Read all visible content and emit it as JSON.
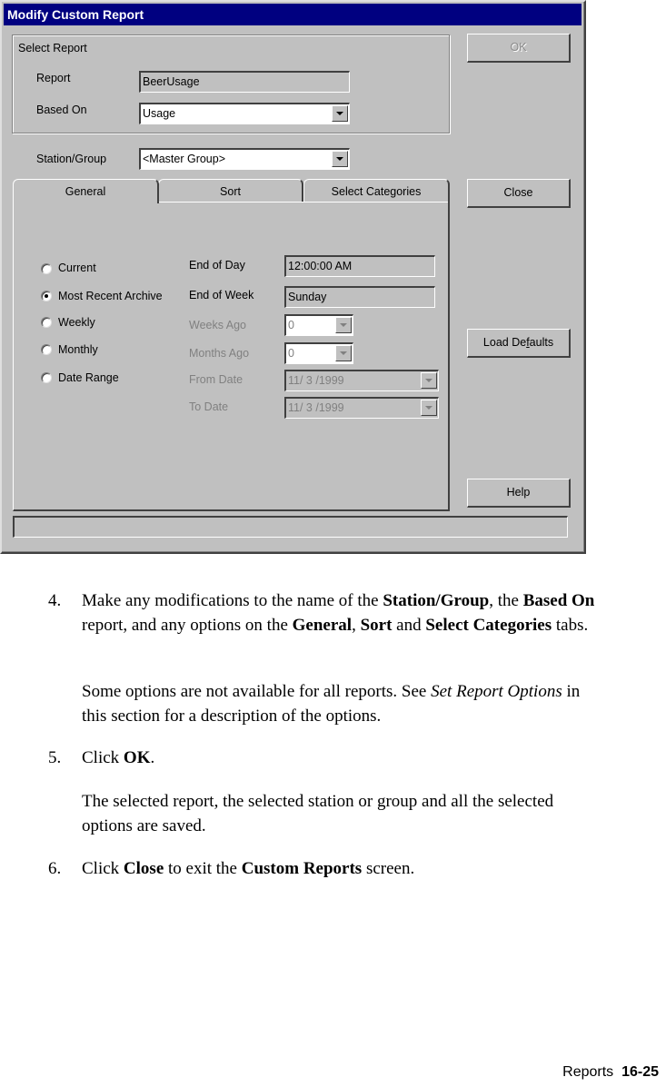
{
  "dialog": {
    "title": "Modify Custom Report",
    "select_report_group": {
      "legend": "Select Report",
      "report_label": "Report",
      "report_value": "BeerUsage",
      "based_on_label": "Based On",
      "based_on_value": "Usage"
    },
    "station_group_label": "Station/Group",
    "station_group_value": "<Master Group>",
    "tabs": [
      {
        "label": "General",
        "active": true
      },
      {
        "label": "Sort",
        "active": false
      },
      {
        "label": "Select Categories",
        "active": false
      }
    ],
    "general": {
      "radios": [
        {
          "label": "Current",
          "checked": false
        },
        {
          "label": "Most Recent Archive",
          "checked": true
        },
        {
          "label": "Weekly",
          "checked": false
        },
        {
          "label": "Monthly",
          "checked": false
        },
        {
          "label": "Date Range",
          "checked": false
        }
      ],
      "end_of_day_label": "End of Day",
      "end_of_day_value": "12:00:00 AM",
      "end_of_week_label": "End of Week",
      "end_of_week_value": "Sunday",
      "weeks_ago_label": "Weeks Ago",
      "weeks_ago_value": "0",
      "months_ago_label": "Months Ago",
      "months_ago_value": "0",
      "from_date_label": "From Date",
      "from_date_value": "11/ 3 /1999",
      "to_date_label": "To Date",
      "to_date_value": "11/ 3 /1999"
    },
    "buttons": {
      "ok": "OK",
      "close": "Close",
      "load_defaults_pre": "Load De",
      "load_defaults_mnemonic": "f",
      "load_defaults_post": "aults",
      "help": "Help"
    },
    "status_text": ""
  },
  "document": {
    "steps": [
      {
        "number": "4.",
        "segments": [
          {
            "text": "Make any modifications to the name of the ",
            "style": "normal"
          },
          {
            "text": "Station/Group",
            "style": "bold"
          },
          {
            "text": ", the ",
            "style": "normal"
          },
          {
            "text": "Based On",
            "style": "bold"
          },
          {
            "text": " report, and any options on the ",
            "style": "normal"
          },
          {
            "text": "General",
            "style": "bold"
          },
          {
            "text": ", ",
            "style": "normal"
          },
          {
            "text": "Sort",
            "style": "bold"
          },
          {
            "text": " and ",
            "style": "normal"
          },
          {
            "text": "Select Categories",
            "style": "bold"
          },
          {
            "text": " tabs.",
            "style": "normal"
          }
        ],
        "note_segments": [
          {
            "text": "Some options are not available for all reports. See ",
            "style": "normal"
          },
          {
            "text": "Set Report Options",
            "style": "italic"
          },
          {
            "text": " in this section for a description of the options.",
            "style": "normal"
          }
        ]
      },
      {
        "number": "5.",
        "segments": [
          {
            "text": "Click ",
            "style": "normal"
          },
          {
            "text": "OK",
            "style": "bold"
          },
          {
            "text": ".",
            "style": "normal"
          }
        ],
        "note_segments": [
          {
            "text": "The selected report, the selected station or group and all the selected options are saved.",
            "style": "normal"
          }
        ]
      },
      {
        "number": "6.",
        "segments": [
          {
            "text": "Click ",
            "style": "normal"
          },
          {
            "text": "Close",
            "style": "bold"
          },
          {
            "text": " to exit the ",
            "style": "normal"
          },
          {
            "text": "Custom Reports",
            "style": "bold"
          },
          {
            "text": " screen.",
            "style": "normal"
          }
        ]
      }
    ],
    "footer": {
      "section": "Reports",
      "page": "16-25"
    }
  }
}
